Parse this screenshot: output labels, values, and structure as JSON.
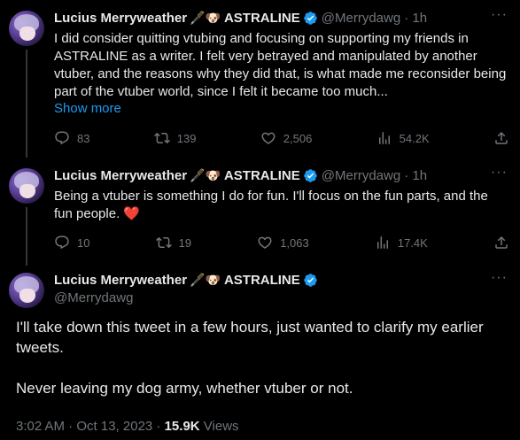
{
  "tweets": [
    {
      "name": "Lucius Merryweather",
      "emoji": "🖋️🐶",
      "brand": "ASTRALINE",
      "handle": "@Merrydawg",
      "time": "· 1h",
      "text": "I did consider quitting vtubing and focusing on supporting my friends in ASTRALINE as a writer. I felt very betrayed and manipulated by another vtuber, and the reasons why they did that, is what made me reconsider being part of the vtuber world, since I felt it became too much...",
      "show_more": "Show more",
      "replies": "83",
      "retweets": "139",
      "likes": "2,506",
      "views": "54.2K"
    },
    {
      "name": "Lucius Merryweather",
      "emoji": "🖋️🐶",
      "brand": "ASTRALINE",
      "handle": "@Merrydawg",
      "time": "· 1h",
      "text": "Being a vtuber is something I do for fun. I'll focus on the fun parts, and the fun people. ❤️",
      "replies": "10",
      "retweets": "19",
      "likes": "1,063",
      "views": "17.4K"
    }
  ],
  "main": {
    "name": "Lucius Merryweather",
    "emoji": "🖋️🐶",
    "brand": "ASTRALINE",
    "handle": "@Merrydawg",
    "para1": "I'll take down this tweet in a few hours, just wanted to clarify my earlier tweets.",
    "para2": "Never leaving my dog army, whether vtuber or not.",
    "timestamp": "3:02 AM · Oct 13, 2023 · ",
    "views_count": "15.9K",
    "views_label": " Views"
  },
  "colors": {
    "accent": "#1d9bf0",
    "background": "#000000",
    "muted": "#71767b"
  }
}
